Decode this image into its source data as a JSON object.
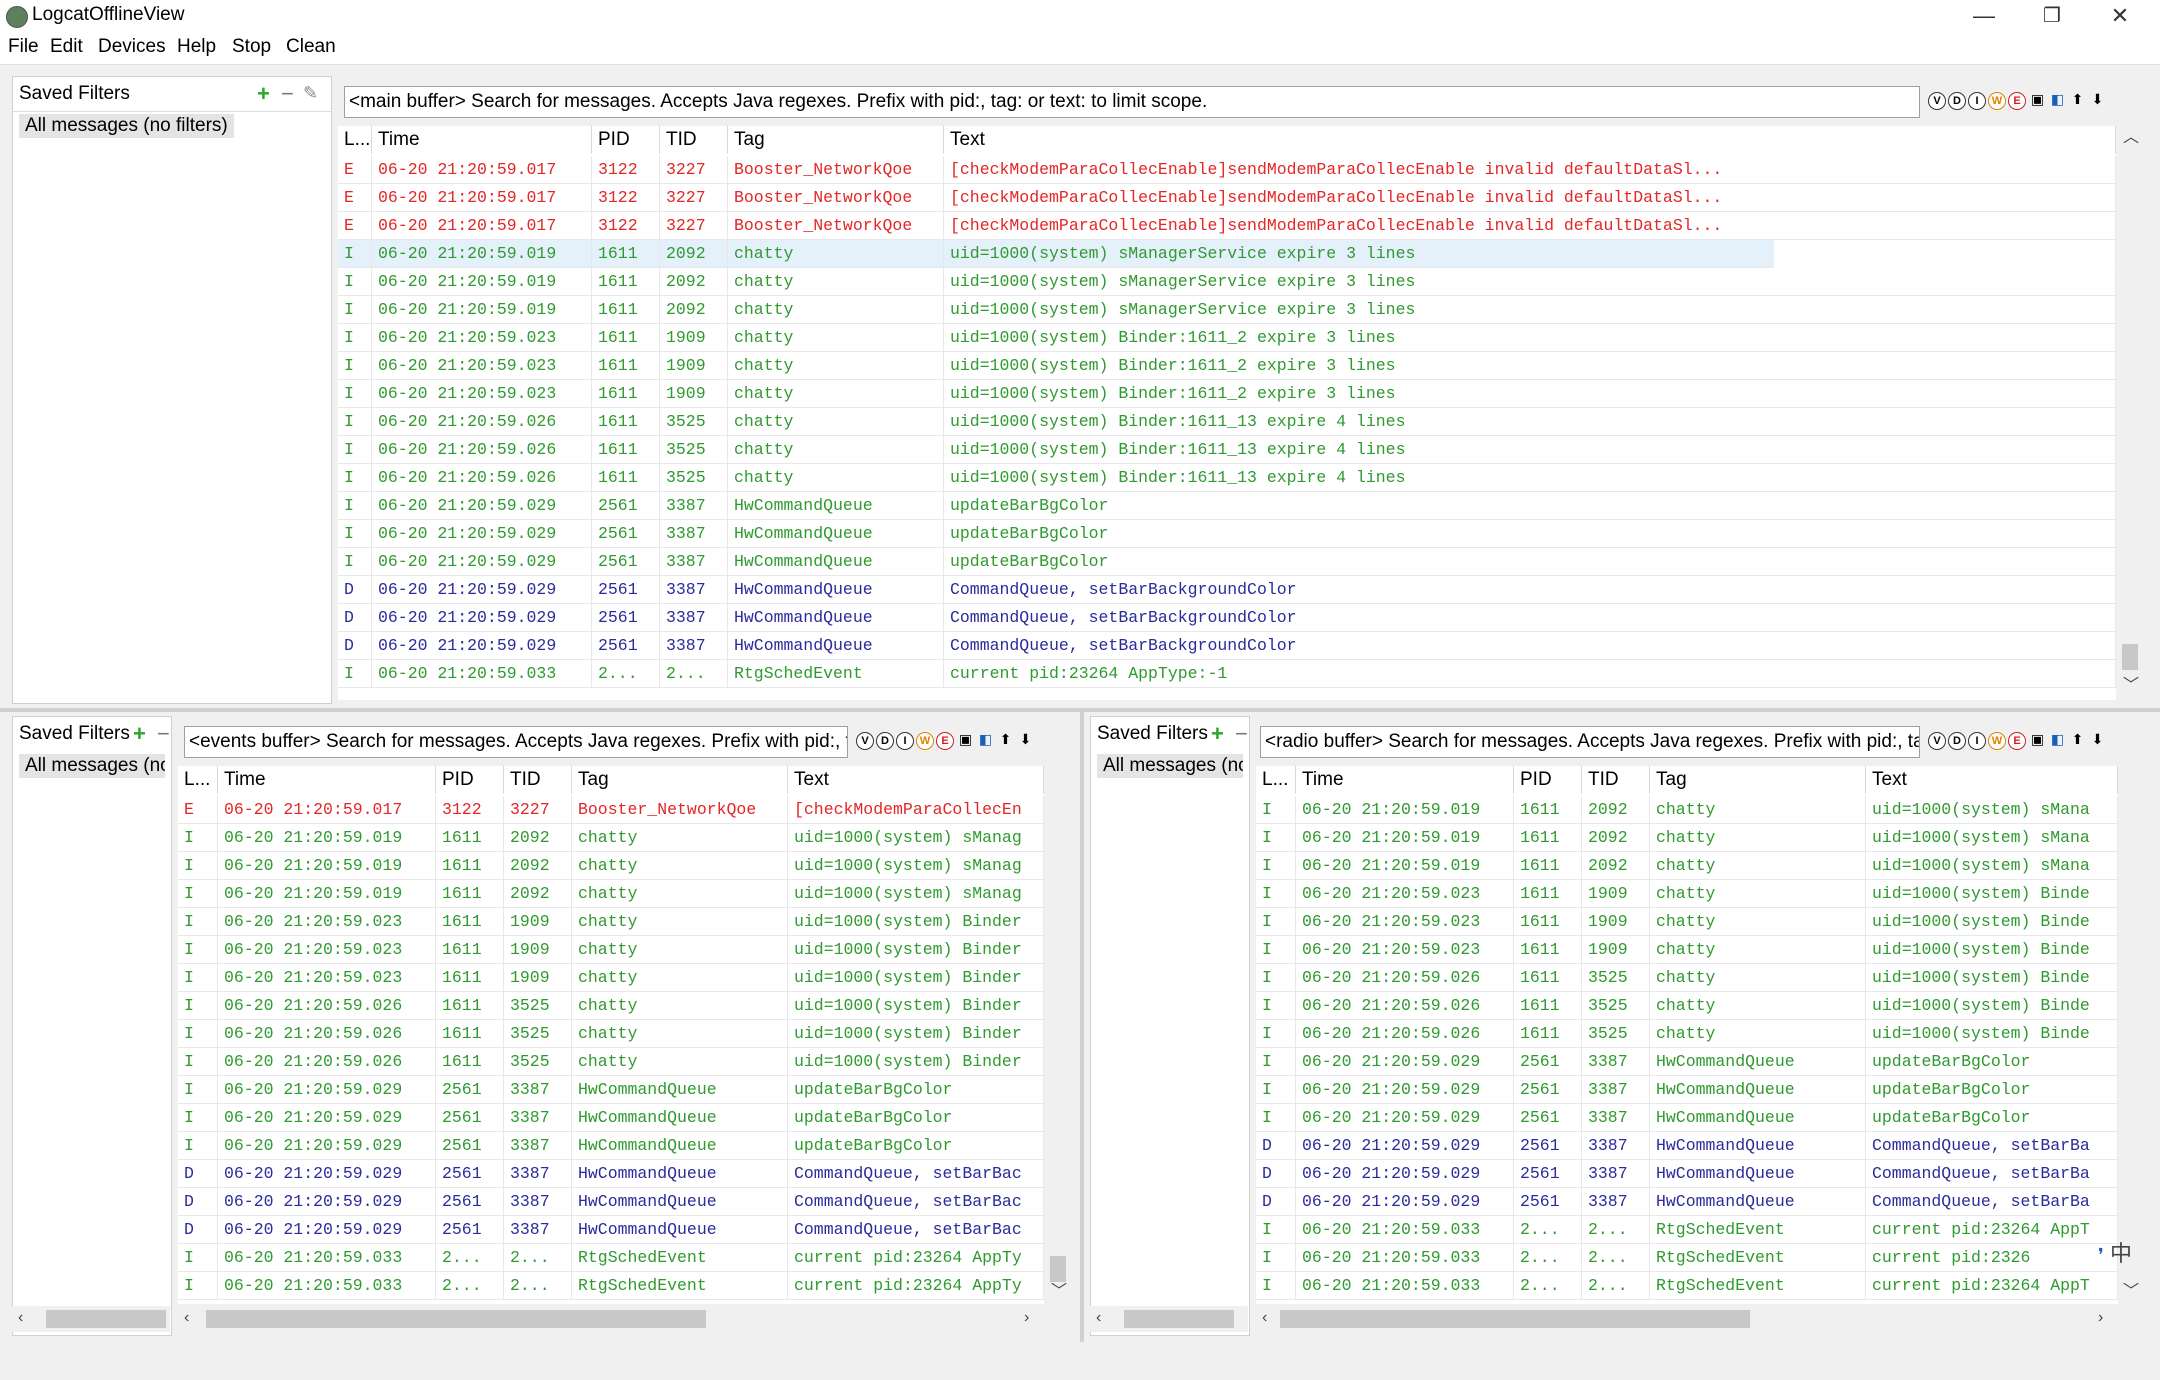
{
  "window": {
    "title": "LogcatOfflineView",
    "min": "—",
    "max": "❐",
    "close": "✕"
  },
  "menu": [
    "File",
    "Edit",
    "Devices",
    "Help",
    "Stop",
    "Clean"
  ],
  "filters": {
    "header": "Saved Filters",
    "all": "All messages (no filters)",
    "all_short": "All messages (no"
  },
  "search": {
    "main": "<main buffer> Search for messages. Accepts Java regexes. Prefix with pid:, tag: or text: to limit scope.",
    "events": "<events buffer> Search for messages. Accepts Java regexes. Prefix with pid:, t",
    "radio": "<radio buffer> Search for messages. Accepts Java regexes. Prefix with pid:, ta"
  },
  "toolbar_icons": [
    "V",
    "D",
    "I",
    "W",
    "E"
  ],
  "columns": {
    "level": "L...",
    "time": "Time",
    "pid": "PID",
    "tid": "TID",
    "tag": "Tag",
    "text": "Text"
  },
  "main_rows": [
    {
      "l": "E",
      "time": "06-20 21:20:59.017",
      "pid": "3122",
      "tid": "3227",
      "tag": "Booster_NetworkQoe",
      "text": "[checkModemParaCollecEnable]sendModemParaCollecEnable invalid defaultDataSl..."
    },
    {
      "l": "E",
      "time": "06-20 21:20:59.017",
      "pid": "3122",
      "tid": "3227",
      "tag": "Booster_NetworkQoe",
      "text": "[checkModemParaCollecEnable]sendModemParaCollecEnable invalid defaultDataSl..."
    },
    {
      "l": "E",
      "time": "06-20 21:20:59.017",
      "pid": "3122",
      "tid": "3227",
      "tag": "Booster_NetworkQoe",
      "text": "[checkModemParaCollecEnable]sendModemParaCollecEnable invalid defaultDataSl..."
    },
    {
      "l": "I",
      "time": "06-20 21:20:59.019",
      "pid": "1611",
      "tid": "2092",
      "tag": "chatty",
      "text": "uid=1000(system) sManagerService expire 3 lines",
      "sel": true
    },
    {
      "l": "I",
      "time": "06-20 21:20:59.019",
      "pid": "1611",
      "tid": "2092",
      "tag": "chatty",
      "text": "uid=1000(system) sManagerService expire 3 lines"
    },
    {
      "l": "I",
      "time": "06-20 21:20:59.019",
      "pid": "1611",
      "tid": "2092",
      "tag": "chatty",
      "text": "uid=1000(system) sManagerService expire 3 lines"
    },
    {
      "l": "I",
      "time": "06-20 21:20:59.023",
      "pid": "1611",
      "tid": "1909",
      "tag": "chatty",
      "text": "uid=1000(system) Binder:1611_2 expire 3 lines"
    },
    {
      "l": "I",
      "time": "06-20 21:20:59.023",
      "pid": "1611",
      "tid": "1909",
      "tag": "chatty",
      "text": "uid=1000(system) Binder:1611_2 expire 3 lines"
    },
    {
      "l": "I",
      "time": "06-20 21:20:59.023",
      "pid": "1611",
      "tid": "1909",
      "tag": "chatty",
      "text": "uid=1000(system) Binder:1611_2 expire 3 lines"
    },
    {
      "l": "I",
      "time": "06-20 21:20:59.026",
      "pid": "1611",
      "tid": "3525",
      "tag": "chatty",
      "text": "uid=1000(system) Binder:1611_13 expire 4 lines"
    },
    {
      "l": "I",
      "time": "06-20 21:20:59.026",
      "pid": "1611",
      "tid": "3525",
      "tag": "chatty",
      "text": "uid=1000(system) Binder:1611_13 expire 4 lines"
    },
    {
      "l": "I",
      "time": "06-20 21:20:59.026",
      "pid": "1611",
      "tid": "3525",
      "tag": "chatty",
      "text": "uid=1000(system) Binder:1611_13 expire 4 lines"
    },
    {
      "l": "I",
      "time": "06-20 21:20:59.029",
      "pid": "2561",
      "tid": "3387",
      "tag": "HwCommandQueue",
      "text": "updateBarBgColor"
    },
    {
      "l": "I",
      "time": "06-20 21:20:59.029",
      "pid": "2561",
      "tid": "3387",
      "tag": "HwCommandQueue",
      "text": "updateBarBgColor"
    },
    {
      "l": "I",
      "time": "06-20 21:20:59.029",
      "pid": "2561",
      "tid": "3387",
      "tag": "HwCommandQueue",
      "text": "updateBarBgColor"
    },
    {
      "l": "D",
      "time": "06-20 21:20:59.029",
      "pid": "2561",
      "tid": "3387",
      "tag": "HwCommandQueue",
      "text": "CommandQueue, setBarBackgroundColor"
    },
    {
      "l": "D",
      "time": "06-20 21:20:59.029",
      "pid": "2561",
      "tid": "3387",
      "tag": "HwCommandQueue",
      "text": "CommandQueue, setBarBackgroundColor"
    },
    {
      "l": "D",
      "time": "06-20 21:20:59.029",
      "pid": "2561",
      "tid": "3387",
      "tag": "HwCommandQueue",
      "text": "CommandQueue, setBarBackgroundColor"
    },
    {
      "l": "I",
      "time": "06-20 21:20:59.033",
      "pid": "2...",
      "tid": "2...",
      "tag": "RtgSchedEvent",
      "text": "current pid:23264 AppType:-1"
    }
  ],
  "events_rows": [
    {
      "l": "E",
      "time": "06-20 21:20:59.017",
      "pid": "3122",
      "tid": "3227",
      "tag": "Booster_NetworkQoe",
      "text": "[checkModemParaCollecEn"
    },
    {
      "l": "I",
      "time": "06-20 21:20:59.019",
      "pid": "1611",
      "tid": "2092",
      "tag": "chatty",
      "text": "uid=1000(system) sManag"
    },
    {
      "l": "I",
      "time": "06-20 21:20:59.019",
      "pid": "1611",
      "tid": "2092",
      "tag": "chatty",
      "text": "uid=1000(system) sManag"
    },
    {
      "l": "I",
      "time": "06-20 21:20:59.019",
      "pid": "1611",
      "tid": "2092",
      "tag": "chatty",
      "text": "uid=1000(system) sManag"
    },
    {
      "l": "I",
      "time": "06-20 21:20:59.023",
      "pid": "1611",
      "tid": "1909",
      "tag": "chatty",
      "text": "uid=1000(system) Binder"
    },
    {
      "l": "I",
      "time": "06-20 21:20:59.023",
      "pid": "1611",
      "tid": "1909",
      "tag": "chatty",
      "text": "uid=1000(system) Binder"
    },
    {
      "l": "I",
      "time": "06-20 21:20:59.023",
      "pid": "1611",
      "tid": "1909",
      "tag": "chatty",
      "text": "uid=1000(system) Binder"
    },
    {
      "l": "I",
      "time": "06-20 21:20:59.026",
      "pid": "1611",
      "tid": "3525",
      "tag": "chatty",
      "text": "uid=1000(system) Binder"
    },
    {
      "l": "I",
      "time": "06-20 21:20:59.026",
      "pid": "1611",
      "tid": "3525",
      "tag": "chatty",
      "text": "uid=1000(system) Binder"
    },
    {
      "l": "I",
      "time": "06-20 21:20:59.026",
      "pid": "1611",
      "tid": "3525",
      "tag": "chatty",
      "text": "uid=1000(system) Binder"
    },
    {
      "l": "I",
      "time": "06-20 21:20:59.029",
      "pid": "2561",
      "tid": "3387",
      "tag": "HwCommandQueue",
      "text": "updateBarBgColor"
    },
    {
      "l": "I",
      "time": "06-20 21:20:59.029",
      "pid": "2561",
      "tid": "3387",
      "tag": "HwCommandQueue",
      "text": "updateBarBgColor"
    },
    {
      "l": "I",
      "time": "06-20 21:20:59.029",
      "pid": "2561",
      "tid": "3387",
      "tag": "HwCommandQueue",
      "text": "updateBarBgColor"
    },
    {
      "l": "D",
      "time": "06-20 21:20:59.029",
      "pid": "2561",
      "tid": "3387",
      "tag": "HwCommandQueue",
      "text": "CommandQueue, setBarBac"
    },
    {
      "l": "D",
      "time": "06-20 21:20:59.029",
      "pid": "2561",
      "tid": "3387",
      "tag": "HwCommandQueue",
      "text": "CommandQueue, setBarBac"
    },
    {
      "l": "D",
      "time": "06-20 21:20:59.029",
      "pid": "2561",
      "tid": "3387",
      "tag": "HwCommandQueue",
      "text": "CommandQueue, setBarBac"
    },
    {
      "l": "I",
      "time": "06-20 21:20:59.033",
      "pid": "2...",
      "tid": "2...",
      "tag": "RtgSchedEvent",
      "text": "current pid:23264 AppTy"
    },
    {
      "l": "I",
      "time": "06-20 21:20:59.033",
      "pid": "2...",
      "tid": "2...",
      "tag": "RtgSchedEvent",
      "text": "current pid:23264 AppTy"
    }
  ],
  "radio_rows": [
    {
      "l": "I",
      "time": "06-20 21:20:59.019",
      "pid": "1611",
      "tid": "2092",
      "tag": "chatty",
      "text": "uid=1000(system) sMana"
    },
    {
      "l": "I",
      "time": "06-20 21:20:59.019",
      "pid": "1611",
      "tid": "2092",
      "tag": "chatty",
      "text": "uid=1000(system) sMana"
    },
    {
      "l": "I",
      "time": "06-20 21:20:59.019",
      "pid": "1611",
      "tid": "2092",
      "tag": "chatty",
      "text": "uid=1000(system) sMana"
    },
    {
      "l": "I",
      "time": "06-20 21:20:59.023",
      "pid": "1611",
      "tid": "1909",
      "tag": "chatty",
      "text": "uid=1000(system) Binde"
    },
    {
      "l": "I",
      "time": "06-20 21:20:59.023",
      "pid": "1611",
      "tid": "1909",
      "tag": "chatty",
      "text": "uid=1000(system) Binde"
    },
    {
      "l": "I",
      "time": "06-20 21:20:59.023",
      "pid": "1611",
      "tid": "1909",
      "tag": "chatty",
      "text": "uid=1000(system) Binde"
    },
    {
      "l": "I",
      "time": "06-20 21:20:59.026",
      "pid": "1611",
      "tid": "3525",
      "tag": "chatty",
      "text": "uid=1000(system) Binde"
    },
    {
      "l": "I",
      "time": "06-20 21:20:59.026",
      "pid": "1611",
      "tid": "3525",
      "tag": "chatty",
      "text": "uid=1000(system) Binde"
    },
    {
      "l": "I",
      "time": "06-20 21:20:59.026",
      "pid": "1611",
      "tid": "3525",
      "tag": "chatty",
      "text": "uid=1000(system) Binde"
    },
    {
      "l": "I",
      "time": "06-20 21:20:59.029",
      "pid": "2561",
      "tid": "3387",
      "tag": "HwCommandQueue",
      "text": "updateBarBgColor"
    },
    {
      "l": "I",
      "time": "06-20 21:20:59.029",
      "pid": "2561",
      "tid": "3387",
      "tag": "HwCommandQueue",
      "text": "updateBarBgColor"
    },
    {
      "l": "I",
      "time": "06-20 21:20:59.029",
      "pid": "2561",
      "tid": "3387",
      "tag": "HwCommandQueue",
      "text": "updateBarBgColor"
    },
    {
      "l": "D",
      "time": "06-20 21:20:59.029",
      "pid": "2561",
      "tid": "3387",
      "tag": "HwCommandQueue",
      "text": "CommandQueue, setBarBa"
    },
    {
      "l": "D",
      "time": "06-20 21:20:59.029",
      "pid": "2561",
      "tid": "3387",
      "tag": "HwCommandQueue",
      "text": "CommandQueue, setBarBa"
    },
    {
      "l": "D",
      "time": "06-20 21:20:59.029",
      "pid": "2561",
      "tid": "3387",
      "tag": "HwCommandQueue",
      "text": "CommandQueue, setBarBa"
    },
    {
      "l": "I",
      "time": "06-20 21:20:59.033",
      "pid": "2...",
      "tid": "2...",
      "tag": "RtgSchedEvent",
      "text": "current pid:23264 AppT"
    },
    {
      "l": "I",
      "time": "06-20 21:20:59.033",
      "pid": "2...",
      "tid": "2...",
      "tag": "RtgSchedEvent",
      "text": "current pid:2326"
    },
    {
      "l": "I",
      "time": "06-20 21:20:59.033",
      "pid": "2...",
      "tid": "2...",
      "tag": "RtgSchedEvent",
      "text": "current pid:23264 AppT"
    }
  ],
  "ime": "中",
  "colors": {
    "error": "#e32626",
    "info": "#2f9a2f",
    "debug": "#2b2b9c",
    "selected": "#e4f1fb"
  }
}
